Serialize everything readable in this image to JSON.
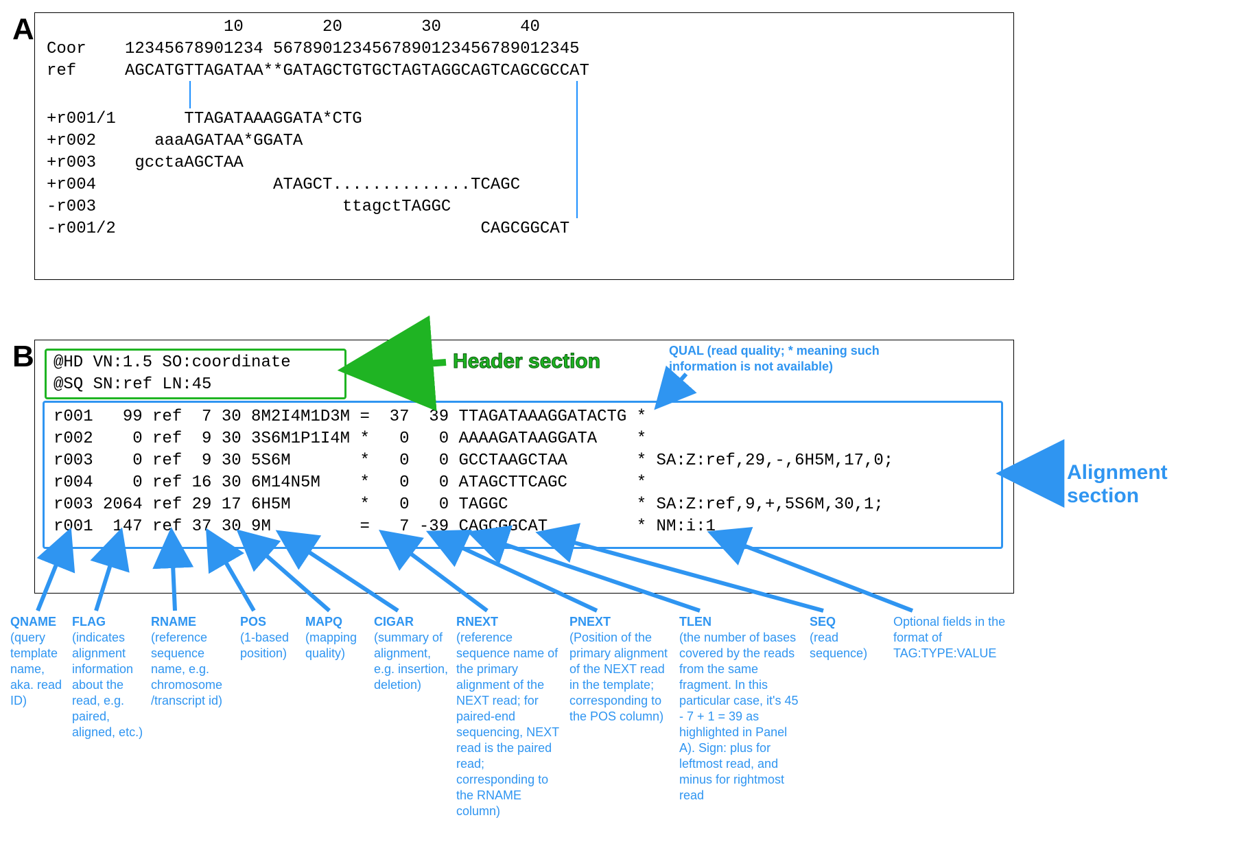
{
  "panels": {
    "a_label": "A",
    "b_label": "B"
  },
  "panel_a": {
    "scale_tens": "          10        20        30        40",
    "scale_units": "12345678901234 5678901234567890123456789012345",
    "rows": [
      {
        "label": "Coor",
        "seq": "12345678901234 5678901234567890123456789012345"
      },
      {
        "label": "ref",
        "seq": "AGCATGTTAGATAA**GATAGCTGTGCTAGTAGGCAGTCAGCGCCAT"
      },
      {
        "label": "+r001/1",
        "seq": "      TTAGATAAAGGATA*CTG"
      },
      {
        "label": "+r002",
        "seq": "   aaaAGATAA*GGATA"
      },
      {
        "label": "+r003",
        "seq": " gcctaAGCTAA"
      },
      {
        "label": "+r004",
        "seq": "               ATAGCT..............TCAGC"
      },
      {
        "label": "-r003",
        "seq": "                      ttagctTAGGC"
      },
      {
        "label": "-r001/2",
        "seq": "                                    CAGCGGCAT"
      }
    ]
  },
  "panel_b": {
    "header_lines": [
      "@HD VN:1.5 SO:coordinate",
      "@SQ SN:ref LN:45"
    ],
    "aln_rows": [
      "r001   99 ref  7 30 8M2I4M1D3M =  37  39 TTAGATAAAGGATACTG *",
      "r002    0 ref  9 30 3S6M1P1I4M *   0   0 AAAAGATAAGGATA    *",
      "r003    0 ref  9 30 5S6M       *   0   0 GCCTAAGCTAA       * SA:Z:ref,29,-,6H5M,17,0;",
      "r004    0 ref 16 30 6M14N5M    *   0   0 ATAGCTTCAGC       *",
      "r003 2064 ref 29 17 6H5M       *   0   0 TAGGC             * SA:Z:ref,9,+,5S6M,30,1;",
      "r001  147 ref 37 30 9M         =   7 -39 CAGCGGCAT         * NM:i:1"
    ],
    "labels": {
      "header": "Header section",
      "alignment": "Alignment section",
      "qual_label": "QUAL (read quality; * meaning such information is not available)",
      "qname": {
        "title": "QNAME",
        "desc": "(query template name, aka. read ID)"
      },
      "flag": {
        "title": "FLAG",
        "desc": "(indicates alignment information about the read, e.g. paired, aligned, etc.)"
      },
      "rname": {
        "title": "RNAME",
        "desc": "(reference sequence name, e.g. chromosome /transcript id)"
      },
      "pos": {
        "title": "POS",
        "desc": "(1-based position)"
      },
      "mapq": {
        "title": "MAPQ",
        "desc": "(mapping quality)"
      },
      "cigar": {
        "title": "CIGAR",
        "desc": "(summary of alignment, e.g. insertion, deletion)"
      },
      "rnext": {
        "title": "RNEXT",
        "desc": "(reference sequence name of the primary alignment of the NEXT read; for paired-end sequencing, NEXT read is the paired read; corresponding to the RNAME column)"
      },
      "pnext": {
        "title": "PNEXT",
        "desc": "(Position of the primary alignment of the NEXT read in the template; corresponding to the POS column)"
      },
      "tlen": {
        "title": "TLEN",
        "desc": "(the number of bases covered by the reads from the same fragment. In this particular case, it's 45 - 7 + 1 = 39 as highlighted in Panel A). Sign: plus for leftmost read, and minus for rightmost read"
      },
      "seq": {
        "title": "SEQ",
        "desc": "(read sequence)"
      },
      "opt": {
        "title": "",
        "desc": "Optional fields in the format of TAG:TYPE:VALUE"
      }
    }
  }
}
